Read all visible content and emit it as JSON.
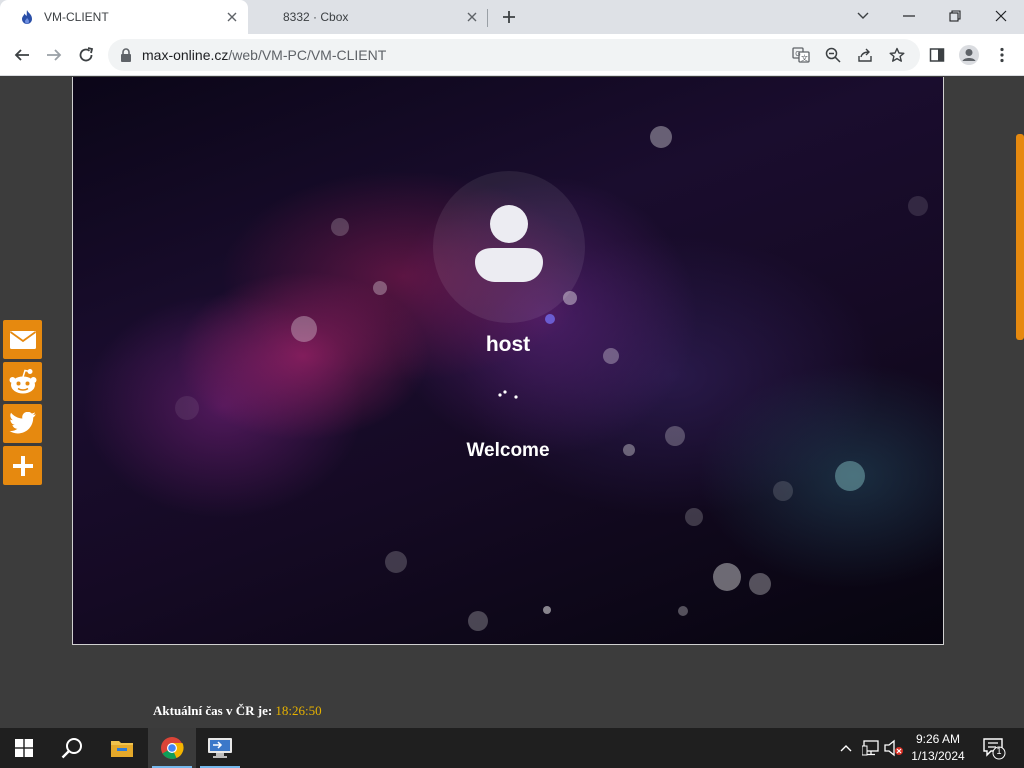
{
  "browser": {
    "tabs": [
      {
        "title": "VM-CLIENT",
        "active": true,
        "favicon": "flame-icon"
      },
      {
        "title": "8332 · Cbox",
        "active": false,
        "favicon": "none"
      }
    ],
    "new_tab_icon": "plus-icon",
    "window_controls": [
      "chevron-down-icon",
      "minimize-icon",
      "restore-icon",
      "close-icon"
    ],
    "address": {
      "host": "max-online.cz",
      "path": "/web/VM-PC/VM-CLIENT"
    },
    "toolbar_icons": [
      "translate-icon",
      "zoom-out-icon",
      "share-icon",
      "star-icon",
      "side-panel-icon",
      "profile-icon",
      "menu-icon"
    ]
  },
  "vm": {
    "username": "host",
    "status": "Welcome"
  },
  "share_buttons": [
    "email-icon",
    "reddit-icon",
    "twitter-icon",
    "plus-icon"
  ],
  "footer": {
    "time_label": "Aktuální čas v ČR je:",
    "time_value": "18:26:50"
  },
  "taskbar": {
    "items": [
      "windows-start-icon",
      "search-icon",
      "file-explorer-icon",
      "chrome-icon",
      "remote-desktop-icon"
    ],
    "active_item": "chrome-icon",
    "tray": [
      "chevron-up-icon",
      "network-icon",
      "volume-muted-icon",
      "notifications-icon"
    ],
    "clock_time": "9:26 AM",
    "clock_date": "1/13/2024",
    "notification_count": "1"
  },
  "colors": {
    "share_orange": "#e6890f",
    "time_yellow": "#e6b200",
    "page_bg": "#3c3c3c"
  }
}
